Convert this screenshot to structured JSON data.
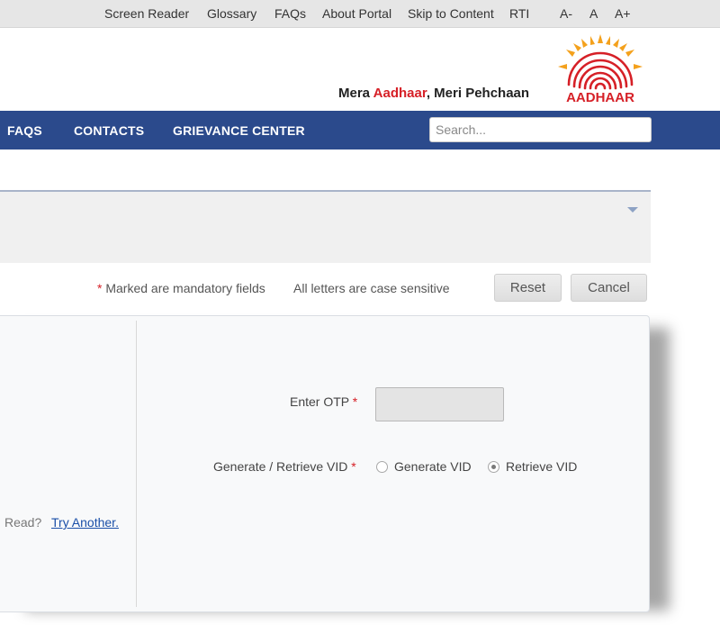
{
  "topbar": {
    "links": [
      "Screen Reader",
      "Glossary",
      "FAQs",
      "About Portal",
      "Skip to Content",
      "RTI"
    ],
    "font_sizes": [
      "A-",
      "A",
      "A+"
    ]
  },
  "header": {
    "tagline_part1": "Mera ",
    "tagline_accent": "Aadhaar",
    "tagline_part2": ", Meri Pehchaan",
    "logo_text": "AADHAAR"
  },
  "nav": {
    "items": [
      "FAQS",
      "CONTACTS",
      "GRIEVANCE CENTER"
    ],
    "search_placeholder": "Search..."
  },
  "info": {
    "mandatory_star": "*",
    "mandatory_text": " Marked are mandatory fields",
    "case_sensitive": "All letters are case sensitive",
    "reset_label": "Reset",
    "cancel_label": "Cancel"
  },
  "form": {
    "otp_label": "Enter OTP",
    "vid_label": "Generate / Retrieve VID",
    "required_star": "*",
    "option_generate": "Generate VID",
    "option_retrieve": "Retrieve VID",
    "selected_option": "Retrieve VID",
    "captcha_prompt": "Read?",
    "captcha_link": "Try Another."
  },
  "colors": {
    "nav_bg": "#2b4a8c",
    "accent_red": "#d62027",
    "logo_orange": "#f4a11c"
  }
}
